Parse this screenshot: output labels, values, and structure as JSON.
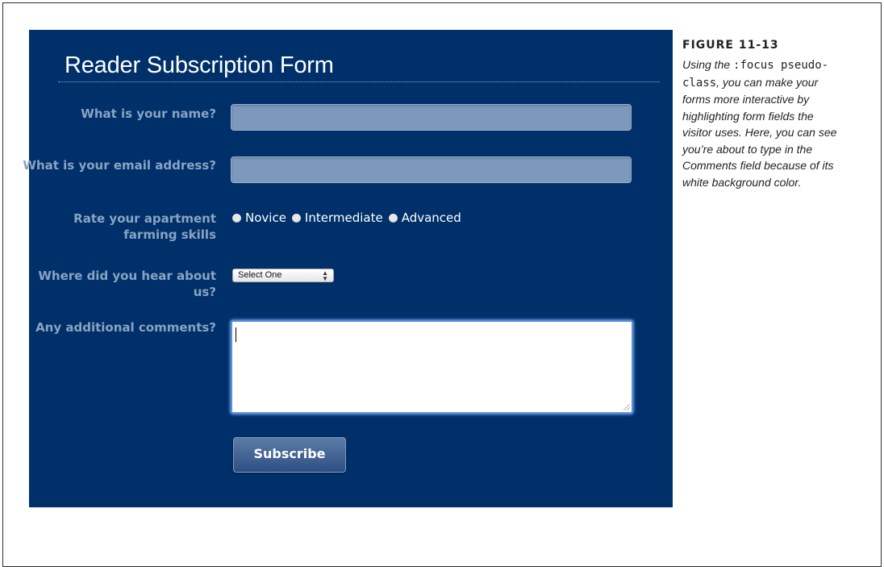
{
  "form": {
    "title": "Reader Subscription Form",
    "fields": {
      "name_label": "What is your name?",
      "email_label": "What is your email address?",
      "skill_label": "Rate your apartment farming skills",
      "skill_options": [
        "Novice",
        "Intermediate",
        "Advanced"
      ],
      "heard_label": "Where did you hear about us?",
      "heard_selected": "Select One",
      "comments_label": "Any additional comments?"
    },
    "submit_label": "Subscribe"
  },
  "caption": {
    "figure_label": "FIGURE 11-13",
    "text_before_code": "Using the ",
    "code": ":focus pseudo-class",
    "text_after_code": ", you can make your forms more interactive by highlighting form fields the visitor uses. Here, you can see you’re about to type in the Comments field because of its white background color."
  },
  "colors": {
    "panel_bg": "#00306a",
    "label_color": "#8aa3c2",
    "input_bg": "#7d98bc",
    "focus_ring": "#5b8fd6"
  }
}
